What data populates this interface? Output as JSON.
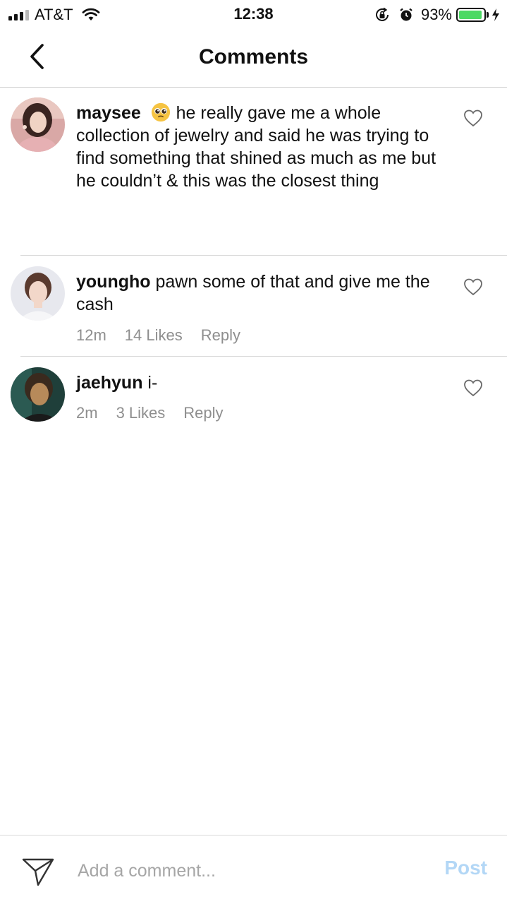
{
  "status_bar": {
    "carrier": "AT&T",
    "time": "12:38",
    "battery_percent": "93%",
    "battery_level": 0.93,
    "icons": [
      "signal-icon",
      "wifi-icon",
      "orientation-lock-icon",
      "alarm-icon",
      "battery-icon",
      "charging-icon"
    ]
  },
  "nav": {
    "title": "Comments",
    "back_icon": "chevron-left-icon"
  },
  "comments": [
    {
      "username": "maysee",
      "emoji": "🥺",
      "text": " he really gave me a whole collection of jewelry and said he was trying to find something that shined as much as me but he couldn’t & this was the closest thing"
    },
    {
      "username": "youngho",
      "text": " pawn some of that and give me the cash",
      "time": "12m",
      "likes": "14 Likes",
      "reply": "Reply"
    },
    {
      "username": "jaehyun",
      "text": " i-",
      "time": "2m",
      "likes": "3 Likes",
      "reply": "Reply"
    }
  ],
  "composer": {
    "placeholder": "Add a comment...",
    "value": "",
    "post_label": "Post",
    "send_icon": "paper-plane-icon"
  },
  "colors": {
    "post_button": "#b3d7f6",
    "meta_text": "#8e8e8e",
    "battery_fill": "#4cd964"
  }
}
